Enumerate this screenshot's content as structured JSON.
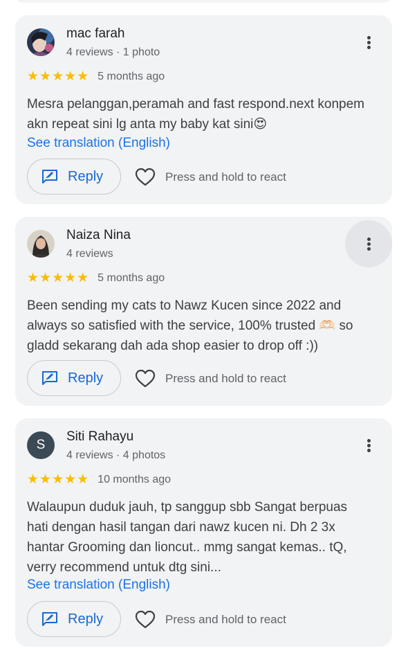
{
  "reviews": [
    {
      "name": "mac farah",
      "meta": "4 reviews · 1 photo",
      "stars": "★★★★★",
      "date": "5 months ago",
      "text": "Mesra pelanggan,peramah and fast respond.next konpem akn repeat sini lg anta my baby kat sini😍",
      "translation_link": "See translation (English)",
      "reply_label": "Reply",
      "react_label": "Press and hold to react",
      "avatar_icon": "profile-photo"
    },
    {
      "name": "Naiza Nina",
      "meta": "4 reviews",
      "stars": "★★★★★",
      "date": "5 months ago",
      "text": "Been sending my cats to Nawz Kucen since 2022 and always so satisfied with the service, 100% trusted 🫶🏻 so gladd sekarang dah ada shop easier to drop off :))",
      "reply_label": "Reply",
      "react_label": "Press and hold to react",
      "avatar_icon": "profile-photo"
    },
    {
      "name": "Siti Rahayu",
      "meta": "4 reviews · 4 photos",
      "avatar_initial": "S",
      "stars": "★★★★★",
      "date": "10 months ago",
      "text": "Walaupun duduk jauh, tp sanggup sbb Sangat berpuas hati dengan hasil tangan dari nawz kucen ni. Dh 2 3x hantar Grooming dan lioncut.. mmg sangat kemas.. tQ, verry recommend untuk dtg sini...",
      "translation_link": "See translation (English)",
      "reply_label": "Reply",
      "react_label": "Press and hold to react"
    }
  ],
  "colors": {
    "card_bg": "#f1f3f4",
    "star": "#fbbc04",
    "link": "#1a73e8",
    "reply": "#1967d2"
  }
}
